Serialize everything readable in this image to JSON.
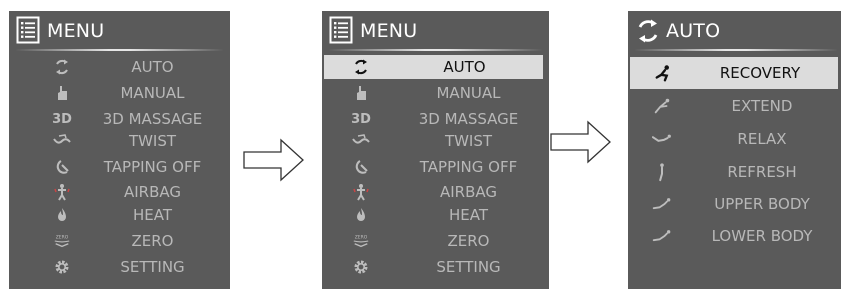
{
  "colors": {
    "screen_bg": "#5a5a5a",
    "text": "#b8b8b8",
    "title": "#ffffff",
    "selected_bg": "#dcdcdc",
    "selected_text": "#111111"
  },
  "screen1": {
    "title": "MENU",
    "title_icon": "menu-list-icon",
    "items": [
      {
        "label": "AUTO",
        "icon": "auto-cycle-icon"
      },
      {
        "label": "MANUAL",
        "icon": "hand-icon"
      },
      {
        "label": "3D MASSAGE",
        "icon": "3d-icon"
      },
      {
        "label": "TWIST",
        "icon": "twist-icon"
      },
      {
        "label": "TAPPING OFF",
        "icon": "tapping-icon"
      },
      {
        "label": "AIRBAG",
        "icon": "airbag-icon"
      },
      {
        "label": "HEAT",
        "icon": "flame-icon"
      },
      {
        "label": "ZERO",
        "icon": "zero-gravity-icon"
      },
      {
        "label": "SETTING",
        "icon": "gear-icon"
      }
    ],
    "icon_3d_text": "3D",
    "zero_icon_text": "ZERO"
  },
  "screen2": {
    "title": "MENU",
    "title_icon": "menu-list-icon",
    "selected": "AUTO",
    "items": [
      {
        "label": "AUTO",
        "icon": "auto-cycle-icon"
      },
      {
        "label": "MANUAL",
        "icon": "hand-icon"
      },
      {
        "label": "3D MASSAGE",
        "icon": "3d-icon"
      },
      {
        "label": "TWIST",
        "icon": "twist-icon"
      },
      {
        "label": "TAPPING OFF",
        "icon": "tapping-icon"
      },
      {
        "label": "AIRBAG",
        "icon": "airbag-icon"
      },
      {
        "label": "HEAT",
        "icon": "flame-icon"
      },
      {
        "label": "ZERO",
        "icon": "zero-gravity-icon"
      },
      {
        "label": "SETTING",
        "icon": "gear-icon"
      }
    ],
    "icon_3d_text": "3D",
    "zero_icon_text": "ZERO"
  },
  "screen3": {
    "title": "AUTO",
    "title_icon": "auto-cycle-icon",
    "selected": "RECOVERY",
    "items": [
      {
        "label": "RECOVERY",
        "icon": "recovery-pose-icon"
      },
      {
        "label": "EXTEND",
        "icon": "extend-pose-icon"
      },
      {
        "label": "RELAX",
        "icon": "relax-pose-icon"
      },
      {
        "label": "REFRESH",
        "icon": "refresh-pose-icon"
      },
      {
        "label": "UPPER BODY",
        "icon": "upper-body-pose-icon"
      },
      {
        "label": "LOWER BODY",
        "icon": "lower-body-pose-icon"
      }
    ]
  }
}
